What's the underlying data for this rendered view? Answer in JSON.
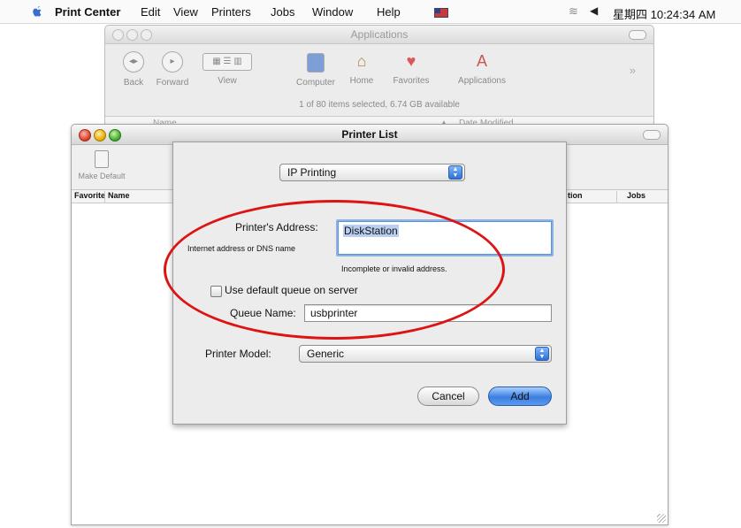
{
  "menubar": {
    "app_name": "Print Center",
    "items": [
      "Edit",
      "View",
      "Printers",
      "Jobs",
      "Window",
      "Help"
    ],
    "clock": "星期四 10:24:34 AM"
  },
  "finder": {
    "title": "Applications",
    "toolbar": [
      "Back",
      "Forward",
      "View",
      "Computer",
      "Home",
      "Favorites",
      "Applications"
    ],
    "status": "1 of 80 items selected, 6.74 GB available",
    "columns": [
      "Name",
      "Date Modified"
    ]
  },
  "printer_list": {
    "title": "Printer List",
    "make_default": "Make Default",
    "columns": [
      "Favorite",
      "Name",
      "tion",
      "Jobs"
    ]
  },
  "sheet": {
    "connection_type": "IP Printing",
    "address_label": "Printer's Address:",
    "address_hint": "Internet address or DNS name",
    "address_value": "DiskStation",
    "error_text": "Incomplete or invalid address.",
    "default_queue_label": "Use default queue on server",
    "default_queue_checked": false,
    "queue_label": "Queue Name:",
    "queue_value": "usbprinter",
    "model_label": "Printer Model:",
    "model_value": "Generic",
    "cancel_label": "Cancel",
    "add_label": "Add"
  },
  "colors": {
    "highlight": "#dd1414",
    "default_button": "#3c7fe0"
  }
}
